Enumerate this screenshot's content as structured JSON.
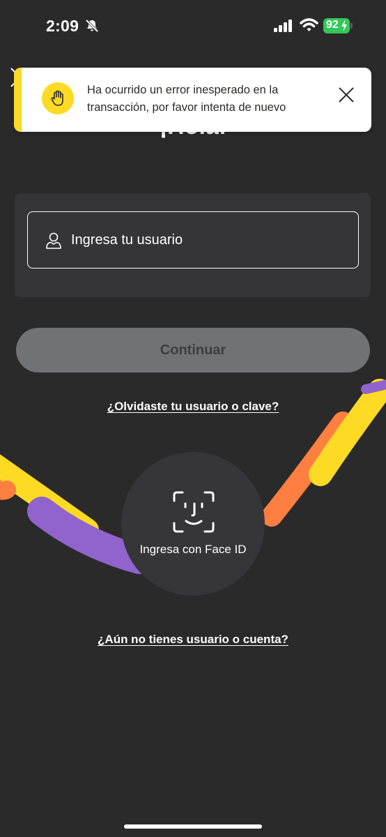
{
  "status_bar": {
    "time": "2:09",
    "battery_level": "92",
    "battery_color": "#34c759",
    "icons": [
      "bell-slash-icon",
      "signal-icon",
      "wifi-icon",
      "battery-charging-icon"
    ]
  },
  "page": {
    "title": "¡Hola!"
  },
  "toast": {
    "message": "Ha ocurrido un error inesperado en la transacción, por favor intenta de nuevo",
    "accent_color": "#ffd829",
    "icon": "hand-stop-icon",
    "close_icon": "close-icon"
  },
  "login": {
    "username_placeholder": "Ingresa tu usuario",
    "username_value": "",
    "continue_label": "Continuar",
    "forgot_link": "¿Olvidaste tu usuario o clave?",
    "faceid_label": "Ingresa con Face ID",
    "signup_link": "¿Aún no tienes usuario o cuenta?"
  },
  "colors": {
    "background": "#2b2a2a",
    "card": "#353437",
    "button_disabled": "#717273",
    "ribbon_yellow": "#fdda24",
    "ribbon_orange": "#ff7f41",
    "ribbon_purple": "#9063cd"
  }
}
